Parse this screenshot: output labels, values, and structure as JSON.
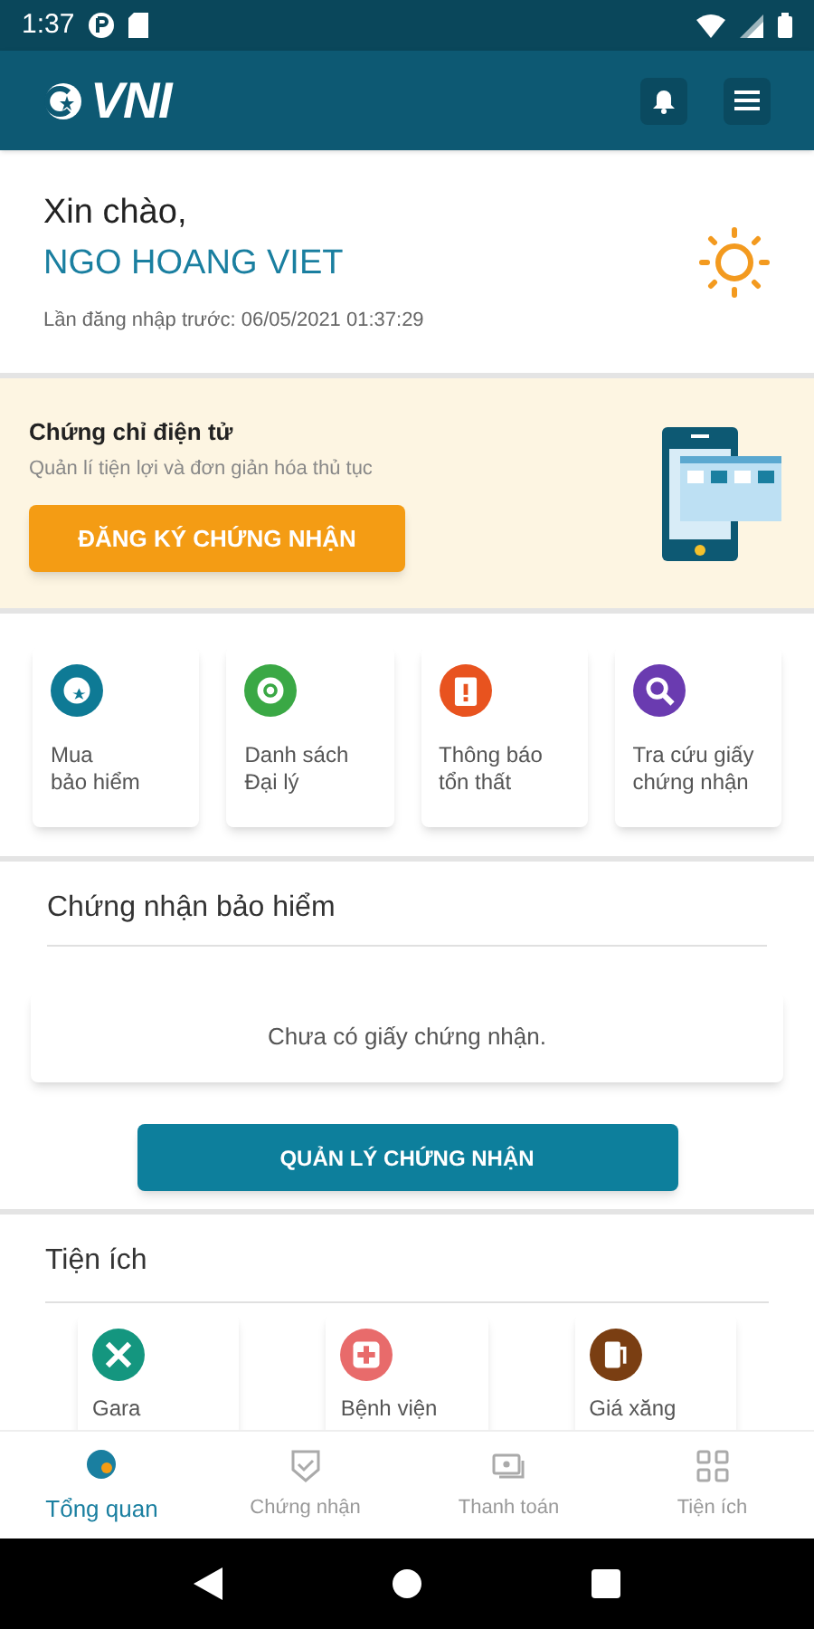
{
  "status_bar": {
    "time": "1:37"
  },
  "app_bar": {
    "logo": "VNI"
  },
  "greeting": {
    "hello": "Xin chào,",
    "name": "NGO HOANG VIET",
    "last_login": "Lần đăng nhập trước: 06/05/2021 01:37:29"
  },
  "banner": {
    "title": "Chứng chỉ điện tử",
    "subtitle": "Quản lí tiện lợi và đơn giản hóa thủ tục",
    "button": "ĐĂNG KÝ CHỨNG NHẬN"
  },
  "quick_actions": [
    {
      "kind": "buy",
      "label": "Mua\nbảo hiểm",
      "color": "#0e7a95"
    },
    {
      "kind": "agents",
      "label": "Danh sách\nĐại lý",
      "color": "#3aa845"
    },
    {
      "kind": "claim",
      "label": "Thông báo\ntổn thất",
      "color": "#e8531f"
    },
    {
      "kind": "lookup",
      "label": "Tra cứu giấy\nchứng nhận",
      "color": "#6a3bb0"
    }
  ],
  "certificates": {
    "title": "Chứng nhận bảo hiểm",
    "empty": "Chưa có giấy chứng nhận.",
    "button": "QUẢN LÝ CHỨNG NHẬN"
  },
  "utilities": {
    "title": "Tiện ích",
    "items": [
      {
        "kind": "garage",
        "label": "Gara",
        "color": "#14967f"
      },
      {
        "kind": "hospital",
        "label": "Bệnh viện",
        "color": "#e86b6b"
      },
      {
        "kind": "fuel",
        "label": "Giá xăng",
        "color": "#7a3e12"
      }
    ]
  },
  "bottom_nav": [
    {
      "kind": "overview",
      "label": "Tổng quan",
      "selected": true
    },
    {
      "kind": "certs",
      "label": "Chứng nhận",
      "selected": false
    },
    {
      "kind": "payment",
      "label": "Thanh toán",
      "selected": false
    },
    {
      "kind": "utilities",
      "label": "Tiện ích",
      "selected": false
    }
  ]
}
